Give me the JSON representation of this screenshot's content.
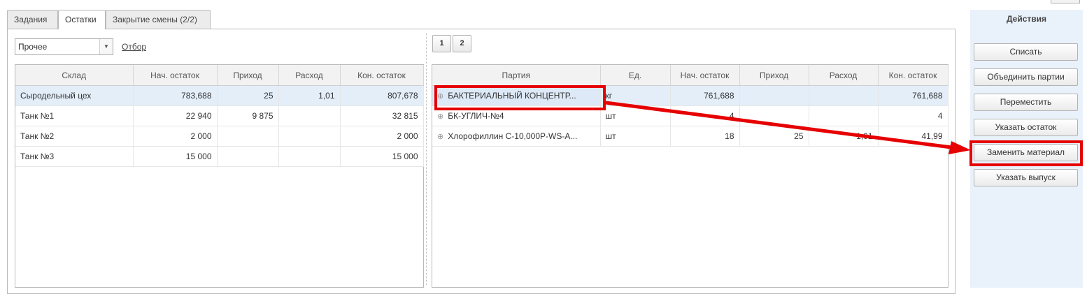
{
  "tabs": [
    "Задания",
    "Остатки",
    "Закрытие смены (2/2)"
  ],
  "filter": {
    "selected": "Прочее",
    "link": "Отбор"
  },
  "pages": [
    "1",
    "2"
  ],
  "warehouse_table": {
    "columns": [
      "Склад",
      "Нач. остаток",
      "Приход",
      "Расход",
      "Кон. остаток"
    ],
    "rows": [
      [
        "Сыродельный цех",
        "783,688",
        "25",
        "1,01",
        "807,678"
      ],
      [
        "Танк №1",
        "22 940",
        "9 875",
        "",
        "32 815"
      ],
      [
        "Танк №2",
        "2 000",
        "",
        "",
        "2 000"
      ],
      [
        "Танк №3",
        "15 000",
        "",
        "",
        "15 000"
      ]
    ]
  },
  "batch_table": {
    "columns": [
      "Партия",
      "Ед.",
      "Нач. остаток",
      "Приход",
      "Расход",
      "Кон. остаток"
    ],
    "rows": [
      [
        "БАКТЕРИАЛЬНЫЙ КОНЦЕНТР...",
        "кг",
        "761,688",
        "",
        "",
        "761,688"
      ],
      [
        "БК-УГЛИЧ-№4",
        "шт",
        "4",
        "",
        "",
        "4"
      ],
      [
        "Хлорофиллин C-10,000P-WS-A...",
        "шт",
        "18",
        "25",
        "1,01",
        "41,99"
      ]
    ]
  },
  "actions": {
    "title": "Действия",
    "buttons": [
      "Списать",
      "Объединить партии",
      "Переместить",
      "Указать остаток",
      "Заменить материал",
      "Указать выпуск"
    ]
  },
  "annotation_color": "#e60000"
}
